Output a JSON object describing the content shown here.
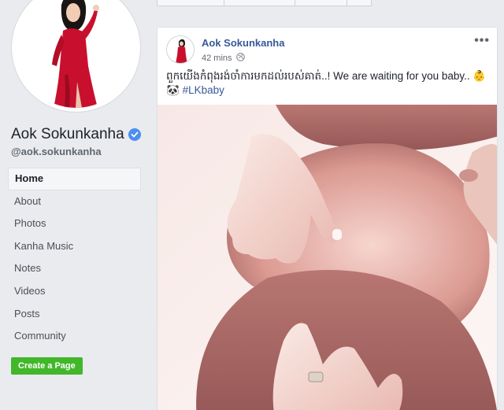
{
  "page": {
    "name": "Aok Sokunkanha",
    "handle": "@aok.sokunkanha",
    "verified": true
  },
  "sidebar": {
    "items": [
      {
        "label": "Home",
        "active": true
      },
      {
        "label": "About"
      },
      {
        "label": "Photos"
      },
      {
        "label": "Kanha Music"
      },
      {
        "label": "Notes"
      },
      {
        "label": "Videos"
      },
      {
        "label": "Posts"
      },
      {
        "label": "Community"
      }
    ],
    "create_page_label": "Create a Page"
  },
  "post": {
    "author": "Aok Sokunkanha",
    "time": "42 mins",
    "menu_icon": "more-horizontal-icon",
    "privacy_icon": "globe-icon",
    "text_khmer": "ពួកយើងកំពុងរង់ចាំការមកដល់របស់គាត់..! We are waiting for you baby.. 👶",
    "text_emoji": "🐼",
    "hashtag": "#LKbaby"
  },
  "colors": {
    "background": "#e9ebee",
    "link": "#385898",
    "verified": "#4b8fef",
    "create_button": "#42b72a"
  }
}
